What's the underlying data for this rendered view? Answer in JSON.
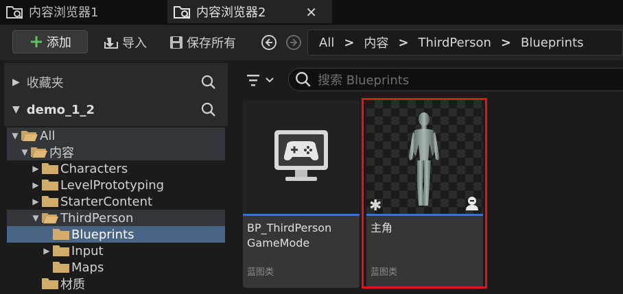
{
  "tabs": [
    {
      "label": "内容浏览器1",
      "icon": "content-browser-icon",
      "active": false
    },
    {
      "label": "内容浏览器2",
      "icon": "content-browser-icon",
      "active": true,
      "close": "✕"
    }
  ],
  "toolbar": {
    "add_label": "添加",
    "import_label": "导入",
    "save_all_label": "保存所有"
  },
  "breadcrumb": [
    "All",
    "内容",
    "ThirdPerson",
    "Blueprints"
  ],
  "left_panel": {
    "favorites_label": "收藏夹",
    "project_label": "demo_1_2",
    "tree": [
      {
        "label": "All",
        "indent": 0,
        "expanded": true
      },
      {
        "label": "内容",
        "indent": 1,
        "expanded": true
      },
      {
        "label": "Characters",
        "indent": 2,
        "expanded": false
      },
      {
        "label": "LevelPrototyping",
        "indent": 2,
        "expanded": false
      },
      {
        "label": "StarterContent",
        "indent": 2,
        "expanded": false
      },
      {
        "label": "ThirdPerson",
        "indent": 2,
        "expanded": true
      },
      {
        "label": "Blueprints",
        "indent": 3,
        "selected": true
      },
      {
        "label": "Input",
        "indent": 3,
        "expanded": false
      },
      {
        "label": "Maps",
        "indent": 3
      },
      {
        "label": "材质",
        "indent": 2
      }
    ]
  },
  "search": {
    "placeholder": "搜索 Blueprints"
  },
  "assets": [
    {
      "title": "BP_ThirdPerson GameMode",
      "type": "蓝图类",
      "icon": "gamemode-monitor-icon"
    },
    {
      "title": "主角",
      "type": "蓝图类",
      "icon": "character-mannequin-icon"
    }
  ],
  "colors": {
    "accent": "#3b6fd6",
    "selection": "#4a6585",
    "highlight_box": "#e3141a",
    "add_plus": "#5ec05e"
  }
}
